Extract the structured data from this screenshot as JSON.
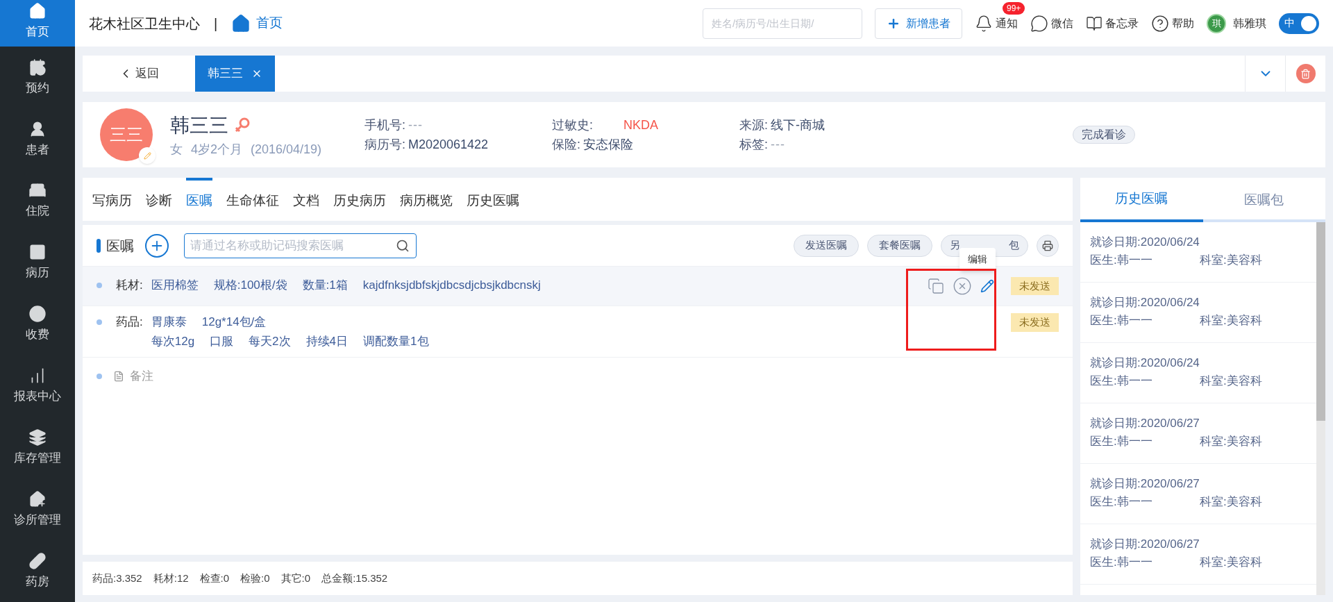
{
  "sidebar": {
    "items": [
      {
        "label": "首页",
        "selected": true
      },
      {
        "label": "预约",
        "selected": false
      },
      {
        "label": "患者",
        "selected": false
      },
      {
        "label": "住院",
        "selected": false
      },
      {
        "label": "病历",
        "selected": false
      },
      {
        "label": "收费",
        "selected": false
      },
      {
        "label": "报表中心",
        "selected": false
      },
      {
        "label": "库存管理",
        "selected": false
      },
      {
        "label": "诊所管理",
        "selected": false
      },
      {
        "label": "药房",
        "selected": false
      }
    ]
  },
  "topbar": {
    "clinic": "花木社区卫生中心",
    "separator": "|",
    "home": "首页",
    "search_placeholder": "姓名/病历号/出生日期/",
    "new_patient": "新增患者",
    "notify": "通知",
    "notify_badge": "99+",
    "wechat": "微信",
    "memo": "备忘录",
    "help": "帮助",
    "avatar": "琪",
    "user": "韩雅琪",
    "lang_toggle": {
      "label": "中",
      "on": true
    }
  },
  "open_tabs": {
    "back": "返回",
    "tabs": [
      {
        "label": "韩三三",
        "selected": true
      }
    ]
  },
  "patient": {
    "avatar": "三三",
    "name": "韩三三",
    "sex": "女",
    "age": "4岁2个月",
    "birth": "(2016/04/19)",
    "fields": [
      {
        "label": "手机号:",
        "placeholder": "---",
        "kind": "empty"
      },
      {
        "label": "病历号:",
        "value": "M2020061422",
        "kind": "normal"
      },
      {
        "label": "过敏史:",
        "value": "NKDA",
        "kind": "alert"
      },
      {
        "label": "保险:",
        "value": "安态保险",
        "kind": "normal"
      },
      {
        "label": "来源:",
        "value": "线下-商城",
        "kind": "normal"
      },
      {
        "label": "标签:",
        "placeholder": "---",
        "kind": "empty"
      }
    ],
    "finish": "完成看诊"
  },
  "tabs": [
    {
      "label": "写病历",
      "selected": false
    },
    {
      "label": "诊断",
      "selected": false
    },
    {
      "label": "医嘱",
      "selected": true
    },
    {
      "label": "生命体征",
      "selected": false
    },
    {
      "label": "文档",
      "selected": false
    },
    {
      "label": "历史病历",
      "selected": false
    },
    {
      "label": "病历概览",
      "selected": false
    },
    {
      "label": "历史医嘱",
      "selected": false
    }
  ],
  "orders": {
    "title": "医嘱",
    "search_placeholder": "请通过名称或助记码搜索医嘱",
    "buttons": [
      "发送医嘱",
      "套餐医嘱"
    ],
    "save_button": {
      "left": "另",
      "right": "包"
    },
    "tooltip": "编辑",
    "rows": [
      {
        "kind": "material",
        "type_label": "耗材:",
        "hovered": true,
        "line1": [
          "医用棉签",
          "规格:100根/袋",
          "数量:1箱",
          "kajdfnksjdbfskjdbcsdjcbsjkdbcnskj"
        ],
        "status": "未发送"
      },
      {
        "kind": "drug",
        "type_label": "药品:",
        "hovered": false,
        "line1": [
          "胃康泰",
          "12g*14包/盒"
        ],
        "line2": [
          "每次12g",
          "口服",
          "每天2次",
          "持续4日",
          "调配数量1包"
        ],
        "status": "未发送"
      }
    ],
    "note": "备注"
  },
  "totals": [
    "药品:3.352",
    "耗材:12",
    "检查:0",
    "检验:0",
    "其它:0",
    "总金额:15.352"
  ],
  "history": {
    "tabs": [
      {
        "label": "历史医嘱",
        "selected": true
      },
      {
        "label": "医嘱包",
        "selected": false
      }
    ],
    "items": [
      {
        "date": "就诊日期:2020/06/24",
        "doctor": "医生:韩一一",
        "dept": "科室:美容科"
      },
      {
        "date": "就诊日期:2020/06/24",
        "doctor": "医生:韩一一",
        "dept": "科室:美容科"
      },
      {
        "date": "就诊日期:2020/06/24",
        "doctor": "医生:韩一一",
        "dept": "科室:美容科"
      },
      {
        "date": "就诊日期:2020/06/27",
        "doctor": "医生:韩一一",
        "dept": "科室:美容科"
      },
      {
        "date": "就诊日期:2020/06/27",
        "doctor": "医生:韩一一",
        "dept": "科室:美容科"
      },
      {
        "date": "就诊日期:2020/06/27",
        "doctor": "医生:韩一一",
        "dept": "科室:美容科"
      }
    ]
  }
}
